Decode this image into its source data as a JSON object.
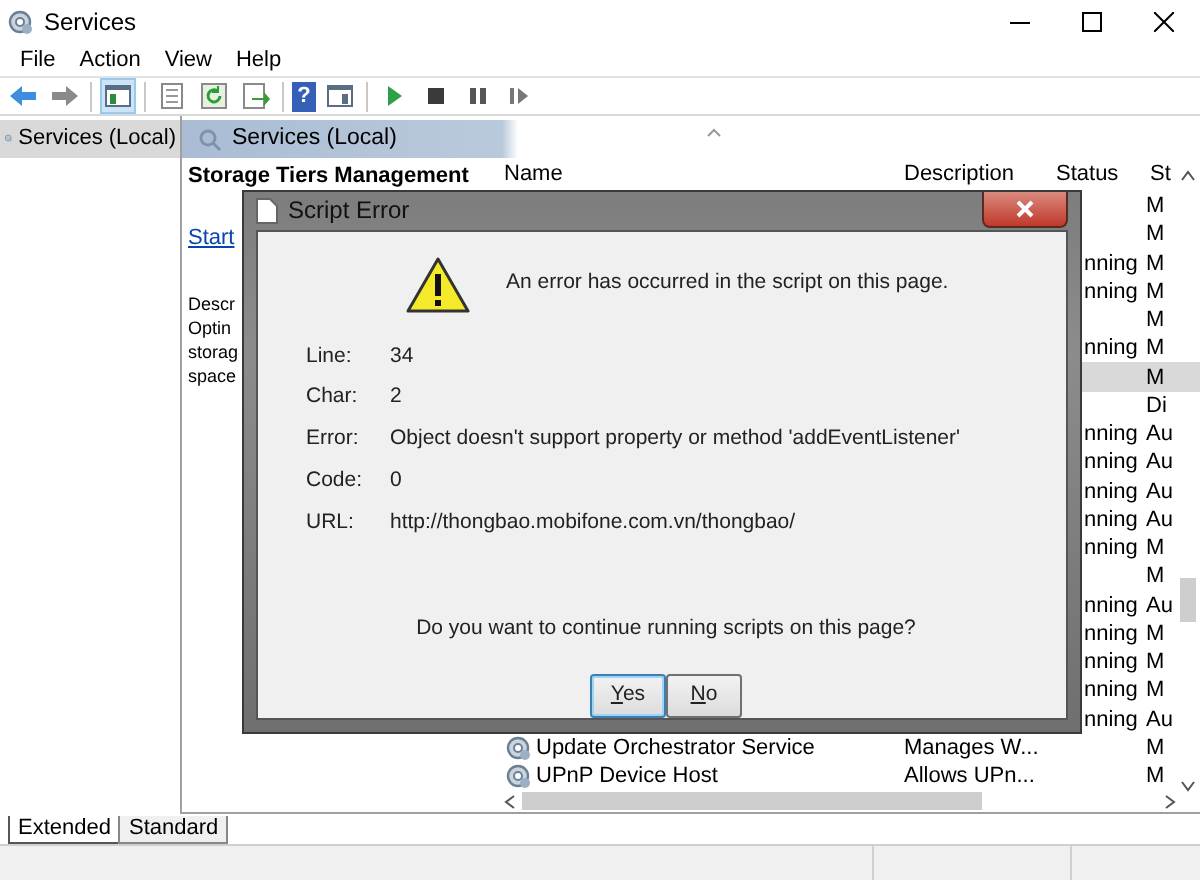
{
  "window": {
    "title": "Services"
  },
  "menu": [
    "File",
    "Action",
    "View",
    "Help"
  ],
  "toolbar": [
    {
      "kind": "back",
      "pressed": false
    },
    {
      "kind": "forward",
      "pressed": false
    },
    {
      "kind": "sep"
    },
    {
      "kind": "tree",
      "pressed": true
    },
    {
      "kind": "sep"
    },
    {
      "kind": "sheet",
      "pressed": false
    },
    {
      "kind": "refresh",
      "pressed": false
    },
    {
      "kind": "export",
      "pressed": false
    },
    {
      "kind": "sep"
    },
    {
      "kind": "help",
      "glyph": "?",
      "pressed": false
    },
    {
      "kind": "view",
      "pressed": false
    },
    {
      "kind": "sep"
    },
    {
      "kind": "play",
      "pressed": false
    },
    {
      "kind": "stop",
      "pressed": false
    },
    {
      "kind": "pause",
      "pressed": false
    },
    {
      "kind": "resume",
      "pressed": false
    }
  ],
  "tree": [
    {
      "label": "Services (Local)",
      "selected": true
    }
  ],
  "panel": {
    "title": "Services (Local)"
  },
  "details": {
    "title": "Storage Tiers Management",
    "link": "Start",
    "description": [
      "Descr",
      "Optin",
      "storag",
      "space"
    ]
  },
  "table": {
    "columns": [
      "Name",
      "Description",
      "Status",
      "St"
    ],
    "rows": [
      {
        "startup": "M",
        "selected": false
      },
      {
        "startup": "M",
        "selected": false
      },
      {
        "status": "nning",
        "startup": "M",
        "selected": false
      },
      {
        "status": "nning",
        "startup": "M",
        "selected": false
      },
      {
        "startup": "M",
        "selected": false
      },
      {
        "status": "nning",
        "startup": "M",
        "selected": false
      },
      {
        "startup": "M",
        "selected": true
      },
      {
        "startup": "Di",
        "selected": false
      },
      {
        "status": "nning",
        "startup": "Au",
        "selected": false
      },
      {
        "status": "nning",
        "startup": "Au",
        "selected": false
      },
      {
        "status": "nning",
        "startup": "Au",
        "selected": false
      },
      {
        "status": "nning",
        "startup": "Au",
        "selected": false
      },
      {
        "status": "nning",
        "startup": "M",
        "selected": false
      },
      {
        "startup": "M",
        "selected": false
      },
      {
        "status": "nning",
        "startup": "Au",
        "selected": false
      },
      {
        "status": "nning",
        "startup": "M",
        "selected": false
      },
      {
        "status": "nning",
        "startup": "M",
        "selected": false
      },
      {
        "status": "nning",
        "startup": "M",
        "selected": false
      },
      {
        "status": "nning",
        "startup": "Au",
        "selected": false
      },
      {
        "name": "Update Orchestrator Service",
        "description": "Manages W...",
        "startup": "M",
        "selected": false
      },
      {
        "name": "UPnP Device Host",
        "description": "Allows UPn...",
        "startup": "M",
        "selected": false
      }
    ]
  },
  "tabs": [
    {
      "label": "Extended",
      "selected": true
    },
    {
      "label": "Standard",
      "selected": false
    }
  ],
  "dialog": {
    "title": "Script Error",
    "message": "An error has occurred in the script on this page.",
    "fields": [
      {
        "label": "Line:",
        "value": "34"
      },
      {
        "label": "Char:",
        "value": "2"
      },
      {
        "label": "Error:",
        "value": "Object doesn't support property or method 'addEventListener'"
      },
      {
        "label": "Code:",
        "value": "0"
      },
      {
        "label": "URL:",
        "value": "http://thongbao.mobifone.com.vn/thongbao/"
      }
    ],
    "question": "Do you want to continue running scripts on this page?",
    "buttons": [
      {
        "label": "Yes",
        "default": true
      },
      {
        "label": "No",
        "default": false
      }
    ]
  }
}
